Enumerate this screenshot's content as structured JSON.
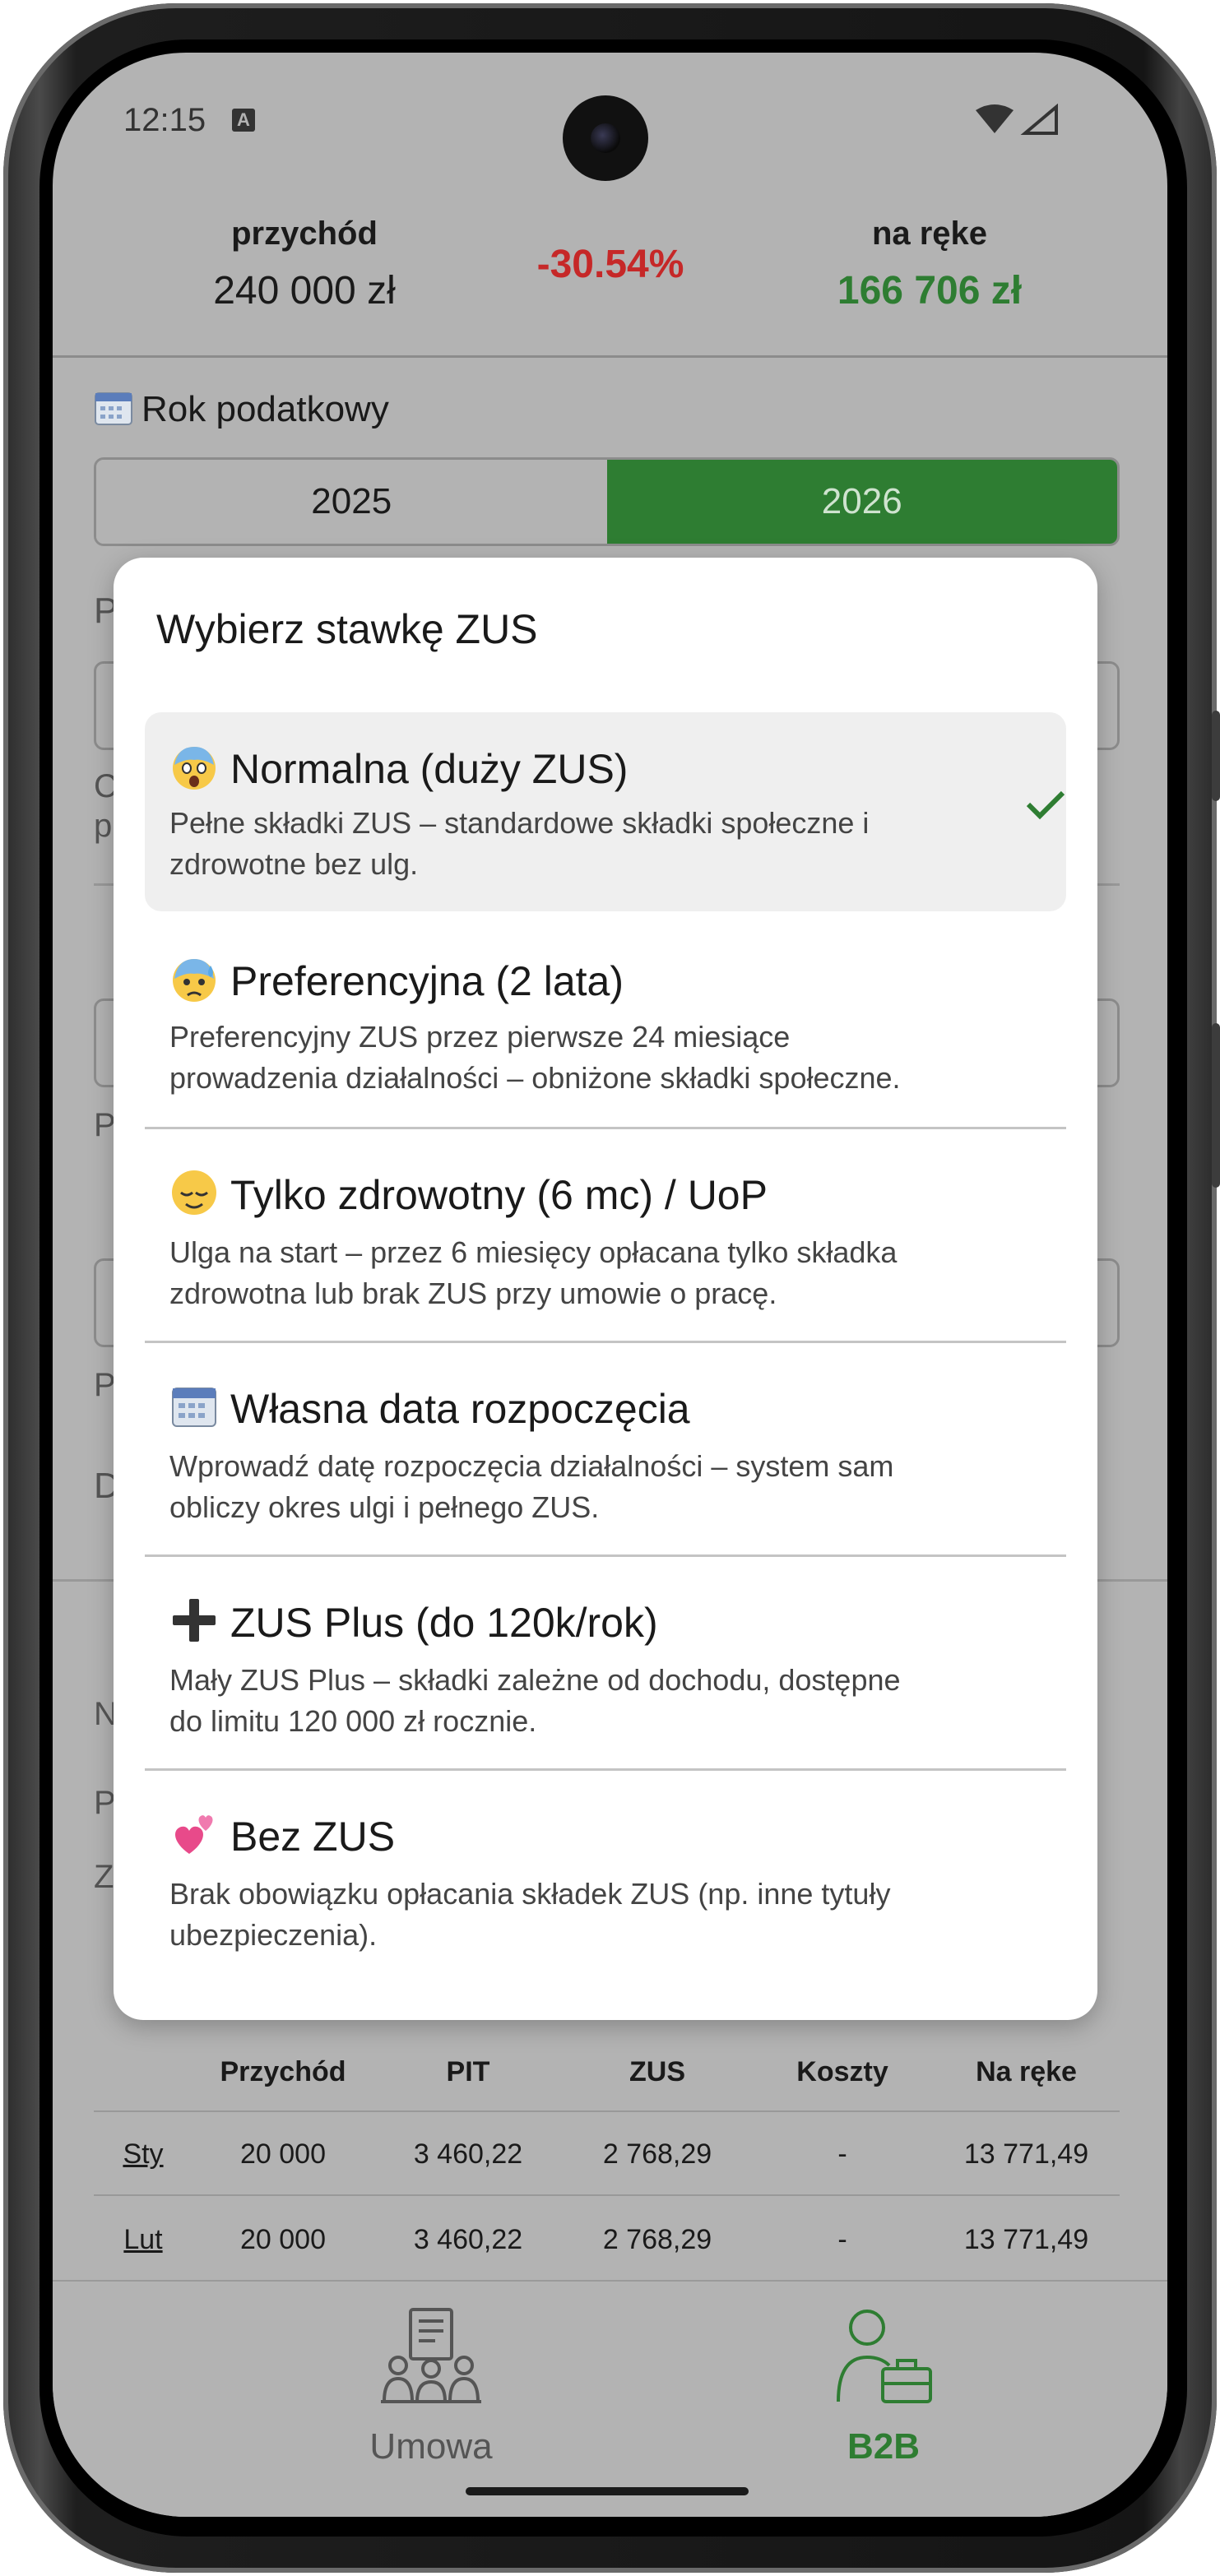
{
  "status_bar": {
    "time": "12:15",
    "a_badge": "A"
  },
  "summary": {
    "income_label": "przychód",
    "income_value": "240 000 zł",
    "percent": "-30.54%",
    "net_label": "na ręke",
    "net_value": "166 706 zł",
    "colors": {
      "negative": "#c62828",
      "positive": "#2e7d32"
    }
  },
  "tax_year": {
    "title": "Rok podatkowy",
    "title_icon": "calendar-icon",
    "options": [
      "2025",
      "2026"
    ],
    "selected": "2026"
  },
  "background_letters": [
    "P",
    "C",
    "p",
    "P",
    "P",
    "D",
    "N",
    "P",
    "Z"
  ],
  "table": {
    "headers": [
      "",
      "Przychód",
      "PIT",
      "ZUS",
      "Koszty",
      "Na ręke"
    ],
    "rows": [
      [
        "Sty",
        "20 000",
        "3 460,22",
        "2 768,29",
        "-",
        "13 771,49"
      ],
      [
        "Lut",
        "20 000",
        "3 460,22",
        "2 768,29",
        "-",
        "13 771,49"
      ]
    ]
  },
  "bottom_nav": {
    "items": [
      {
        "label": "Umowa",
        "icon": "contract-people-icon",
        "active": false
      },
      {
        "label": "B2B",
        "icon": "businessman-briefcase-icon",
        "active": true
      }
    ],
    "active_color": "#2e7d32"
  },
  "dialog": {
    "title": "Wybierz stawkę ZUS",
    "options": [
      {
        "emoji": "scream-face-icon",
        "title": "Normalna (duży ZUS)",
        "desc1": "Pełne składki ZUS – standardowe składki społeczne i",
        "desc2": "zdrowotne bez ulg.",
        "selected": true
      },
      {
        "emoji": "anxious-sweat-face-icon",
        "title": "Preferencyjna (2 lata)",
        "desc1": "Preferencyjny ZUS przez pierwsze 24 miesiące",
        "desc2": "prowadzenia działalności – obniżone składki społeczne.",
        "selected": false
      },
      {
        "emoji": "relieved-face-icon",
        "title": "Tylko zdrowotny (6 mc) / UoP",
        "desc1": "Ulga na start – przez 6 miesięcy opłacana tylko składka",
        "desc2": "zdrowotna lub brak ZUS przy umowie o pracę.",
        "selected": false
      },
      {
        "emoji": "calendar-icon",
        "title": "Własna data rozpoczęcia",
        "desc1": "Wprowadź datę rozpoczęcia działalności – system sam",
        "desc2": "obliczy okres ulgi i pełnego ZUS.",
        "selected": false
      },
      {
        "emoji": "plus-icon",
        "title": "ZUS Plus (do 120k/rok)",
        "desc1": "Mały ZUS Plus – składki zależne od dochodu, dostępne",
        "desc2": "do limitu 120 000 zł rocznie.",
        "selected": false
      },
      {
        "emoji": "two-hearts-icon",
        "title": "Bez ZUS",
        "desc1": "Brak obowiązku opłacania składek ZUS (np. inne tytuły",
        "desc2": "ubezpieczenia).",
        "selected": false
      }
    ],
    "check_color": "#2e7d32"
  }
}
